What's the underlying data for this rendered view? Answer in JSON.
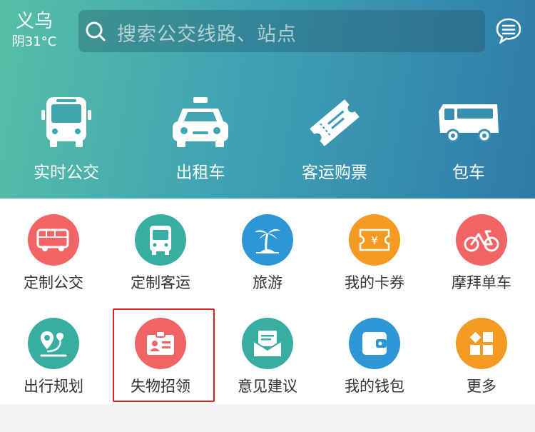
{
  "location": {
    "city": "义乌",
    "weather": "阴31°C"
  },
  "search": {
    "placeholder": "搜索公交线路、站点"
  },
  "top_nav": [
    {
      "label": "实时公交",
      "icon": "bus-front-icon"
    },
    {
      "label": "出租车",
      "icon": "taxi-icon"
    },
    {
      "label": "客运购票",
      "icon": "ticket-icon"
    },
    {
      "label": "包车",
      "icon": "coach-bus-icon"
    }
  ],
  "services": [
    {
      "label": "定制公交",
      "icon": "custom-bus-icon",
      "color": "#f06466"
    },
    {
      "label": "定制客运",
      "icon": "custom-coach-icon",
      "color": "#3aada3"
    },
    {
      "label": "旅游",
      "icon": "palm-island-icon",
      "color": "#2f96d6"
    },
    {
      "label": "我的卡券",
      "icon": "coupon-yen-icon",
      "color": "#f29a22"
    },
    {
      "label": "摩拜单车",
      "icon": "bicycle-icon",
      "color": "#f06466"
    },
    {
      "label": "出行规划",
      "icon": "route-plan-icon",
      "color": "#3aada3"
    },
    {
      "label": "失物招领",
      "icon": "lost-found-icon",
      "color": "#f06466"
    },
    {
      "label": "意见建议",
      "icon": "feedback-mail-icon",
      "color": "#3aada3"
    },
    {
      "label": "我的钱包",
      "icon": "wallet-icon",
      "color": "#2f96d6"
    },
    {
      "label": "更多",
      "icon": "more-grid-icon",
      "color": "#f29a22"
    }
  ]
}
